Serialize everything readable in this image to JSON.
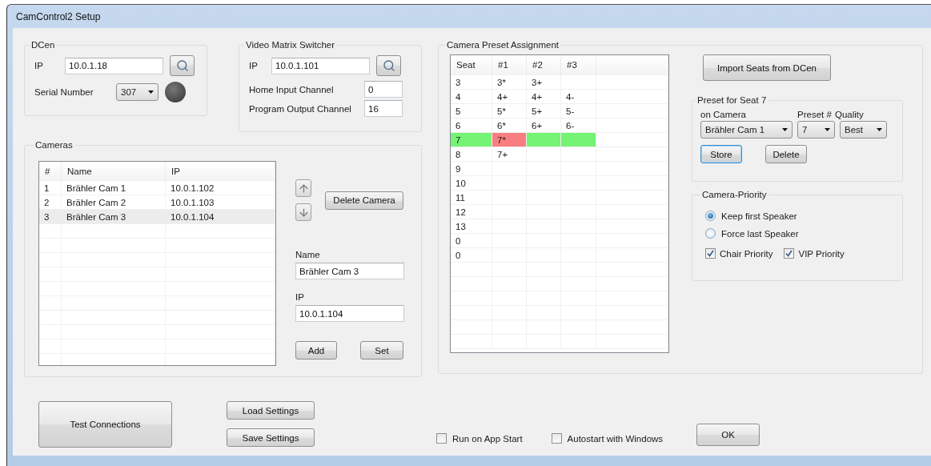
{
  "window": {
    "title": "CamControl2 Setup"
  },
  "dcen": {
    "title": "DCen",
    "ip_label": "IP",
    "ip": "10.0.1.18",
    "serial_label": "Serial Number",
    "serial": "307",
    "connected": false
  },
  "video_matrix": {
    "title": "Video Matrix Switcher",
    "ip_label": "IP",
    "ip": "10.0.1.101",
    "home_input_label": "Home Input Channel",
    "home_input": "0",
    "program_output_label": "Program Output Channel",
    "program_output": "16"
  },
  "cameras": {
    "title": "Cameras",
    "columns": [
      "#",
      "Name",
      "IP"
    ],
    "rows": [
      {
        "cells": [
          "1",
          "Brähler Cam 1",
          "10.0.1.102"
        ],
        "selected": false
      },
      {
        "cells": [
          "2",
          "Brähler Cam 2",
          "10.0.1.103"
        ],
        "selected": false
      },
      {
        "cells": [
          "3",
          "Brähler Cam 3",
          "10.0.1.104"
        ],
        "selected": true
      }
    ],
    "delete_button": "Delete Camera",
    "name_label": "Name",
    "name": "Brähler Cam 3",
    "ip_label": "IP",
    "ip": "10.0.1.104",
    "add_button": "Add",
    "set_button": "Set"
  },
  "preset_assignment": {
    "title": "Camera Preset Assignment",
    "columns": [
      "Seat",
      "#1",
      "#2",
      "#3"
    ],
    "rows": [
      {
        "cells": [
          "3",
          "3*",
          "3+"
        ],
        "selected": false,
        "first_preset_flagged": false
      },
      {
        "cells": [
          "4",
          "4+",
          "4+",
          "4-"
        ],
        "selected": false,
        "first_preset_flagged": false
      },
      {
        "cells": [
          "5",
          "5*",
          "5+",
          "5-"
        ],
        "selected": false,
        "first_preset_flagged": false
      },
      {
        "cells": [
          "6",
          "6*",
          "6+",
          "6-"
        ],
        "selected": false,
        "first_preset_flagged": false
      },
      {
        "cells": [
          "7",
          "7*"
        ],
        "selected": true,
        "first_preset_flagged": true
      },
      {
        "cells": [
          "8",
          "7+"
        ],
        "selected": false,
        "first_preset_flagged": false
      },
      {
        "cells": [
          "9"
        ],
        "selected": false,
        "first_preset_flagged": false
      },
      {
        "cells": [
          "10"
        ],
        "selected": false,
        "first_preset_flagged": false
      },
      {
        "cells": [
          "11"
        ],
        "selected": false,
        "first_preset_flagged": false
      },
      {
        "cells": [
          "12"
        ],
        "selected": false,
        "first_preset_flagged": false
      },
      {
        "cells": [
          "13"
        ],
        "selected": false,
        "first_preset_flagged": false
      },
      {
        "cells": [
          "0"
        ],
        "selected": false,
        "first_preset_flagged": false
      },
      {
        "cells": [
          "0"
        ],
        "selected": false,
        "first_preset_flagged": false
      }
    ],
    "import_button": "Import Seats from DCen",
    "preset": {
      "title": "Preset for Seat 7",
      "camera_label": "on Camera",
      "camera": "Brähler Cam 1",
      "preset_label": "Preset #",
      "preset": "7",
      "quality_label": "Quality",
      "quality": "Best",
      "buttons": [
        {
          "label": "Store",
          "focused": true
        },
        {
          "label": "Delete",
          "focused": false
        }
      ]
    },
    "priority": {
      "title": "Camera-Priority",
      "options": [
        {
          "label": "Keep first Speaker",
          "selected": true
        },
        {
          "label": "Force last Speaker",
          "selected": false
        }
      ],
      "checks": [
        {
          "label": "Chair Priority",
          "checked": true
        },
        {
          "label": "VIP Priority",
          "checked": true
        }
      ]
    }
  },
  "footer": {
    "test_button": "Test Connections",
    "load_button": "Load Settings",
    "save_button": "Save Settings",
    "checks": [
      {
        "label": "Run on App Start",
        "checked": false
      },
      {
        "label": "Autostart with Windows",
        "checked": false
      }
    ],
    "ok_button": "OK"
  }
}
